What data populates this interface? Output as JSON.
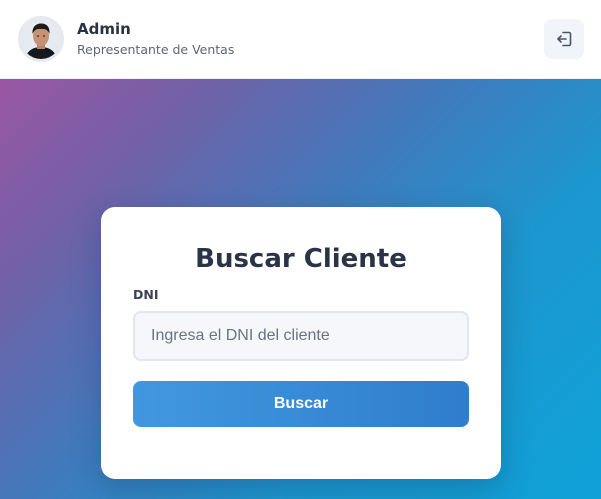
{
  "header": {
    "user_name": "Admin",
    "user_role": "Representante de Ventas",
    "avatar_icon": "user-avatar-photo",
    "logout_icon": "logout-icon"
  },
  "search_card": {
    "title": "Buscar Cliente",
    "dni_label": "DNI",
    "dni_value": "",
    "dni_placeholder": "Ingresa el DNI del cliente",
    "search_button_label": "Buscar"
  },
  "colors": {
    "accent": "#3a8ad8",
    "background_gradient_start": "#9b56a2",
    "background_gradient_end": "#0ea2d8",
    "card_background": "#ffffff",
    "title_text": "#2b3447"
  }
}
